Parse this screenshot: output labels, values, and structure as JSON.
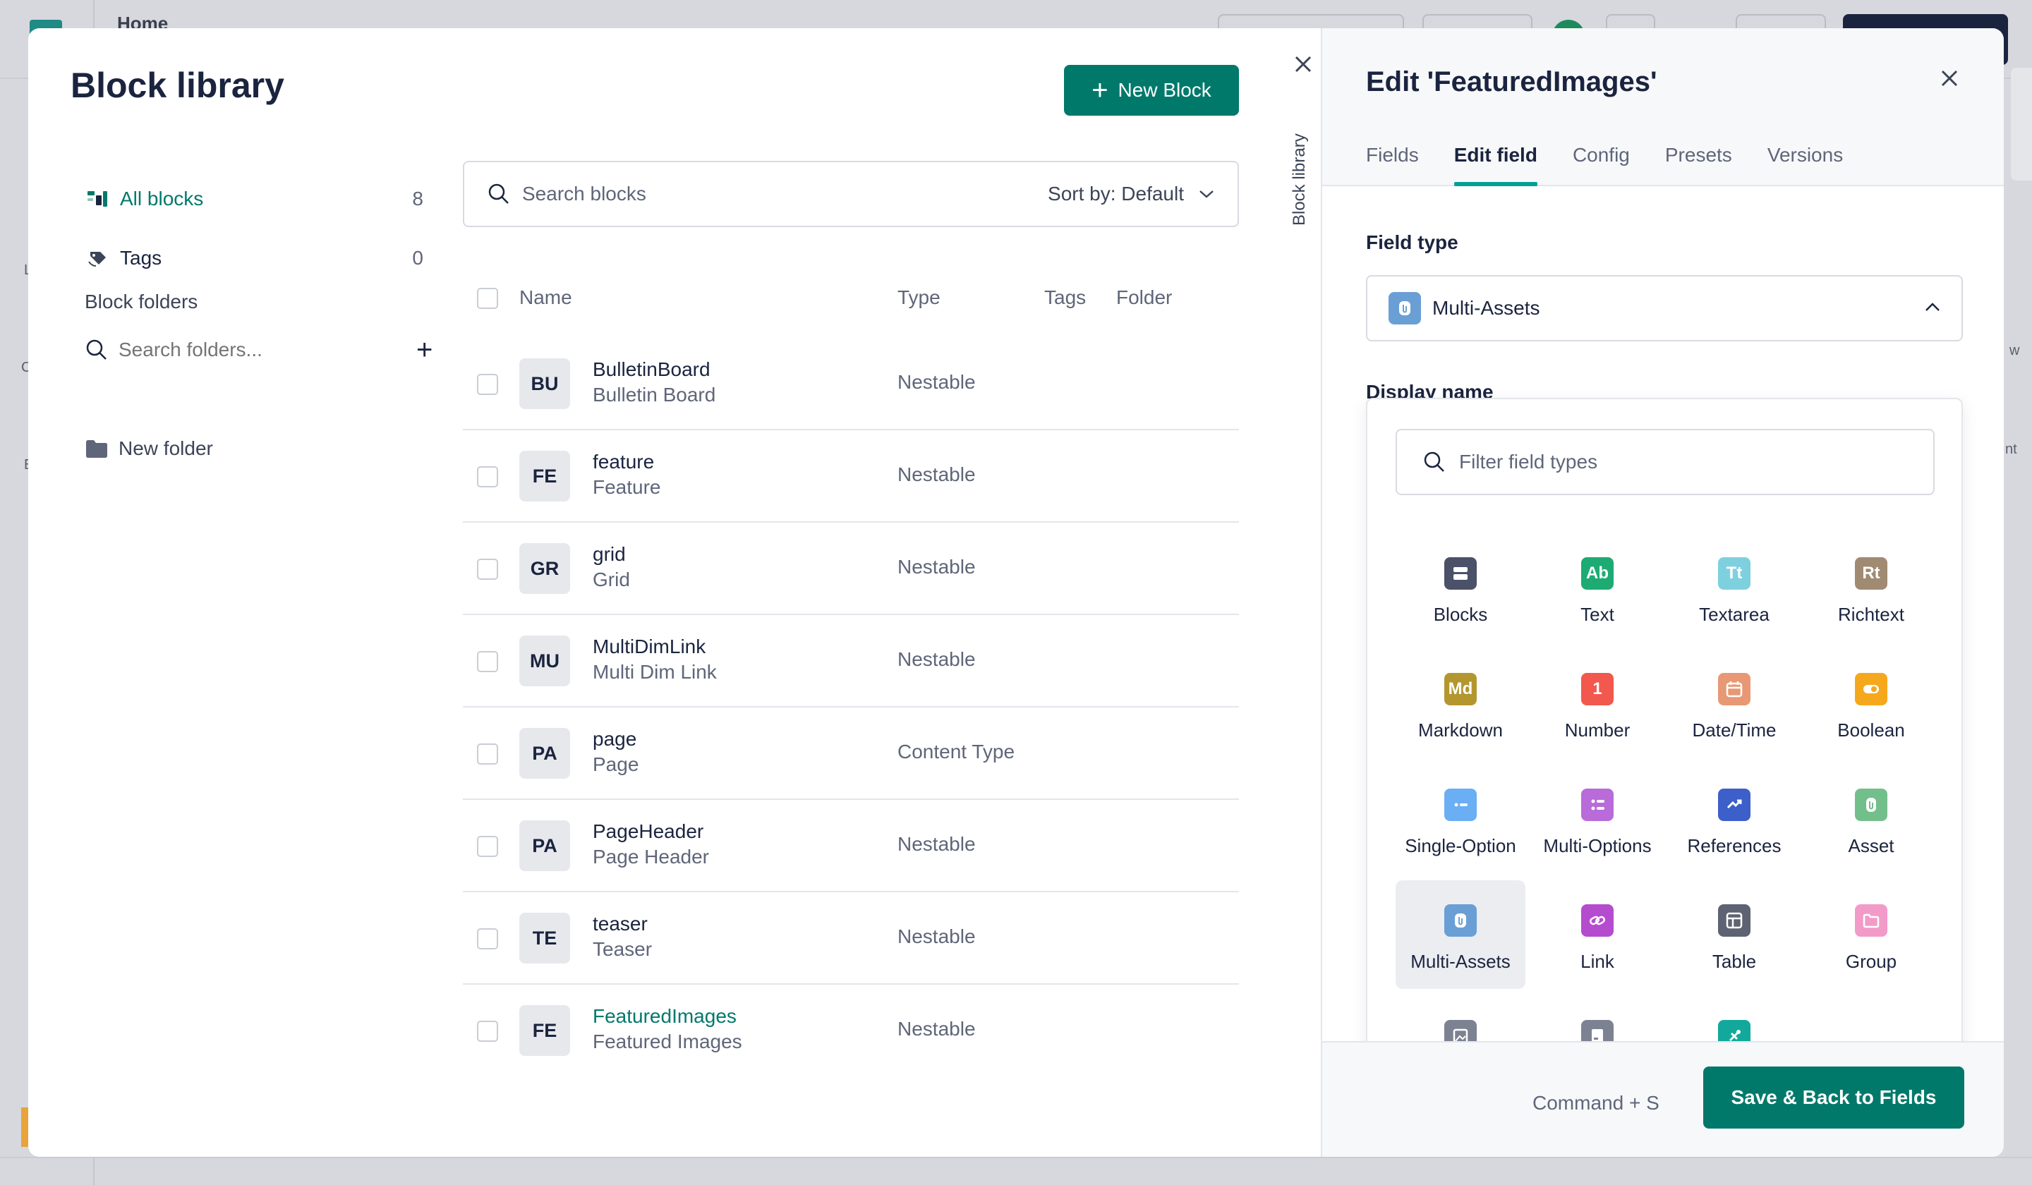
{
  "background": {
    "title": "Home",
    "edge_letters": [
      "L",
      "C",
      "E"
    ],
    "right_edge_text": [
      "w",
      "nt"
    ]
  },
  "library": {
    "title": "Block library",
    "new_block_label": "New Block",
    "vertical_label": "Block library",
    "nav": {
      "all_blocks_label": "All blocks",
      "all_blocks_count": "8",
      "tags_label": "Tags",
      "tags_count": "0",
      "folders_heading": "Block folders",
      "folder_search_placeholder": "Search folders...",
      "new_folder_label": "New folder"
    },
    "search": {
      "placeholder": "Search blocks",
      "sort_label": "Sort by: Default"
    },
    "columns": {
      "name": "Name",
      "type": "Type",
      "tags": "Tags",
      "folder": "Folder"
    },
    "rows": [
      {
        "badge": "BU",
        "name": "BulletinBoard",
        "display": "Bulletin Board",
        "type": "Nestable"
      },
      {
        "badge": "FE",
        "name": "feature",
        "display": "Feature",
        "type": "Nestable"
      },
      {
        "badge": "GR",
        "name": "grid",
        "display": "Grid",
        "type": "Nestable"
      },
      {
        "badge": "MU",
        "name": "MultiDimLink",
        "display": "Multi Dim Link",
        "type": "Nestable"
      },
      {
        "badge": "PA",
        "name": "page",
        "display": "Page",
        "type": "Content Type"
      },
      {
        "badge": "PA",
        "name": "PageHeader",
        "display": "Page Header",
        "type": "Nestable"
      },
      {
        "badge": "TE",
        "name": "teaser",
        "display": "Teaser",
        "type": "Nestable"
      },
      {
        "badge": "FE",
        "name": "FeaturedImages",
        "display": "Featured Images",
        "type": "Nestable"
      }
    ]
  },
  "editor": {
    "title": "Edit 'FeaturedImages'",
    "tabs": [
      {
        "label": "Fields"
      },
      {
        "label": "Edit field"
      },
      {
        "label": "Config"
      },
      {
        "label": "Presets"
      },
      {
        "label": "Versions"
      }
    ],
    "active_tab": "Edit field",
    "field_type_label": "Field type",
    "field_type_value": "Multi-Assets",
    "display_name_label": "Display name",
    "filter_placeholder": "Filter field types",
    "field_types": [
      {
        "label": "Blocks",
        "icon": "blocks-icon",
        "glyph": "",
        "color": "#4a5168"
      },
      {
        "label": "Text",
        "icon": "text-icon",
        "glyph": "Ab",
        "color": "#1dab73"
      },
      {
        "label": "Textarea",
        "icon": "textarea-icon",
        "glyph": "Tt",
        "color": "#7fd0de"
      },
      {
        "label": "Richtext",
        "icon": "richtext-icon",
        "glyph": "Rt",
        "color": "#a08a72"
      },
      {
        "label": "Markdown",
        "icon": "markdown-icon",
        "glyph": "Md",
        "color": "#b3962e"
      },
      {
        "label": "Number",
        "icon": "number-icon",
        "glyph": "1",
        "color": "#f2584d"
      },
      {
        "label": "Date/Time",
        "icon": "calendar-icon",
        "glyph": "",
        "color": "#e89874"
      },
      {
        "label": "Boolean",
        "icon": "toggle-icon",
        "glyph": "",
        "color": "#f6a81c"
      },
      {
        "label": "Single-Option",
        "icon": "single-option-icon",
        "glyph": "",
        "color": "#6aaef4"
      },
      {
        "label": "Multi-Options",
        "icon": "multi-options-icon",
        "glyph": "",
        "color": "#b86bd9"
      },
      {
        "label": "References",
        "icon": "references-icon",
        "glyph": "",
        "color": "#3d5fc9"
      },
      {
        "label": "Asset",
        "icon": "asset-icon",
        "glyph": "",
        "color": "#72bf8c"
      },
      {
        "label": "Multi-Assets",
        "icon": "multi-assets-icon",
        "glyph": "",
        "color": "#6a9fd6"
      },
      {
        "label": "Link",
        "icon": "link-icon",
        "glyph": "",
        "color": "#b54ccf"
      },
      {
        "label": "Table",
        "icon": "table-icon",
        "glyph": "",
        "color": "#5d6372"
      },
      {
        "label": "Group",
        "icon": "folder-icon",
        "glyph": "",
        "color": "#f29bc9"
      },
      {
        "label": "",
        "icon": "image-icon",
        "glyph": "",
        "color": "#7d8292"
      },
      {
        "label": "",
        "icon": "document-icon",
        "glyph": "",
        "color": "#7d8292"
      },
      {
        "label": "",
        "icon": "plugin-icon",
        "glyph": "",
        "color": "#12a99c"
      }
    ],
    "selected_field_type": "Multi-Assets",
    "shortcut_label": "Command + S",
    "save_label": "Save & Back to Fields"
  },
  "colors": {
    "accent": "#00796b",
    "tab_underline": "#00a095",
    "text_primary": "#1b243f",
    "text_secondary": "#5f6679"
  }
}
